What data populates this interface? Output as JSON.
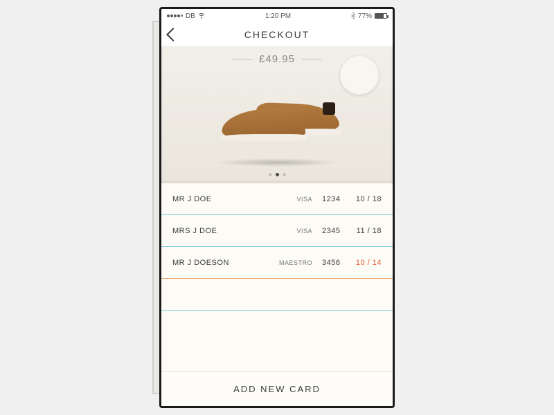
{
  "status": {
    "carrier": "DB",
    "time": "1:20 PM",
    "battery_pct": "77%"
  },
  "header": {
    "title": "CHECKOUT"
  },
  "product": {
    "price": "£49.95",
    "pager_count": 3,
    "pager_active": 1
  },
  "cards": [
    {
      "name": "MR J DOE",
      "brand": "VISA",
      "last4": "1234",
      "exp": "10 / 18",
      "expired": false
    },
    {
      "name": "MRS J DOE",
      "brand": "VISA",
      "last4": "2345",
      "exp": "11 / 18",
      "expired": false
    },
    {
      "name": "MR J DOESON",
      "brand": "MAESTRO",
      "last4": "3456",
      "exp": "10 / 14",
      "expired": true
    }
  ],
  "actions": {
    "add_card": "ADD NEW CARD"
  }
}
